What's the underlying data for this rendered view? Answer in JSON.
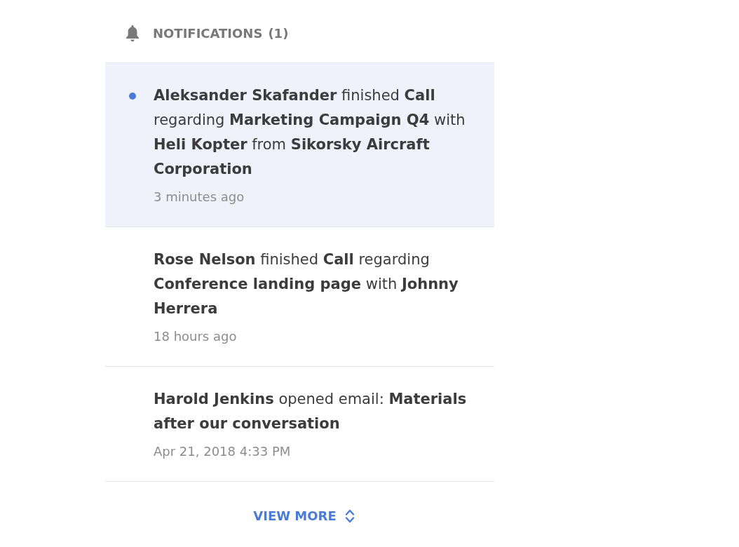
{
  "header": {
    "title": "NOTIFICATIONS",
    "count": "(1)"
  },
  "notifications": [
    {
      "text": "**Aleksander Skafander** finished **Call** regarding **Marketing Campaign Q4** with **Heli Kopter** from **Sikorsky Aircraft Corporation**",
      "time": "3 minutes ago",
      "unread": true
    },
    {
      "text": "**Rose Nelson** finished **Call** regarding **Conference landing page** with **Johnny Herrera**",
      "time": "18 hours ago",
      "unread": false
    },
    {
      "text": "**Harold Jenkins** opened email: **Materials after our conversation**",
      "time": "Apr 21, 2018 4:33 PM",
      "unread": false
    }
  ],
  "view_more": {
    "label": "VIEW MORE"
  }
}
